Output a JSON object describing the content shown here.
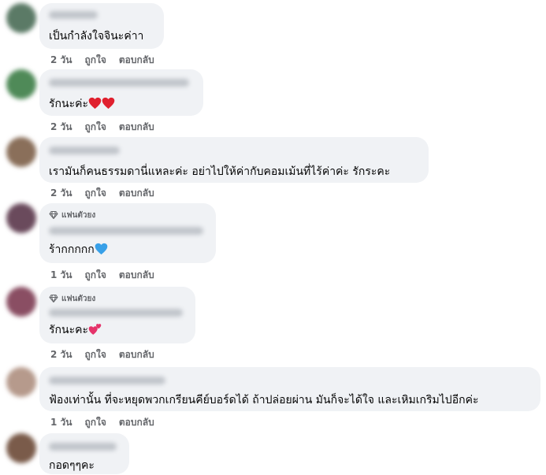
{
  "comments": [
    {
      "text": "เป็นกำลังใจจินะค่าา",
      "emoji": [],
      "badge": "",
      "time": "2 วัน",
      "like": "ถูกใจ",
      "reply": "ตอบกลับ",
      "avatar_color": "#5b7a66"
    },
    {
      "text": "รักนะค่ะ",
      "emoji": [
        "red-heart-icon",
        "red-heart-icon"
      ],
      "badge": "",
      "time": "2 วัน",
      "like": "ถูกใจ",
      "reply": "ตอบกลับ",
      "avatar_color": "#4f8a58"
    },
    {
      "text": "เรามันก็คนธรรมดานี่แหละค่ะ อย่าไปให้ค่ากับคอมเม้นที่ไร้ค่าค่ะ รักระคะ",
      "emoji": [],
      "badge": "",
      "time": "2 วัน",
      "like": "ถูกใจ",
      "reply": "ตอบกลับ",
      "avatar_color": "#8a6f5a"
    },
    {
      "text": "ร้ากกกกก",
      "emoji": [
        "blue-heart-icon"
      ],
      "badge": "แฟนตัวยง",
      "time": "1 วัน",
      "like": "ถูกใจ",
      "reply": "ตอบกลับ",
      "avatar_color": "#6a4a5c"
    },
    {
      "text": "รักนะคะ",
      "emoji": [
        "two-hearts-icon"
      ],
      "badge": "แฟนตัวยง",
      "time": "2 วัน",
      "like": "ถูกใจ",
      "reply": "ตอบกลับ",
      "avatar_color": "#8a4e63"
    },
    {
      "text": "ฟ้องเท่านั้น ที่จะหยุดพวกเกรียนคีย์บอร์ดได้ ถ้าปล่อยผ่าน มันก็จะได้ใจ และเหิมเกริมไปอีกค่ะ",
      "emoji": [],
      "badge": "",
      "time": "1 วัน",
      "like": "ถูกใจ",
      "reply": "ตอบกลับ",
      "avatar_color": "#b69a8c"
    },
    {
      "text": "กอดๆๆคะ",
      "emoji": [],
      "badge": "",
      "time": "",
      "like": "",
      "reply": "",
      "avatar_color": "#7a5b4a"
    }
  ]
}
